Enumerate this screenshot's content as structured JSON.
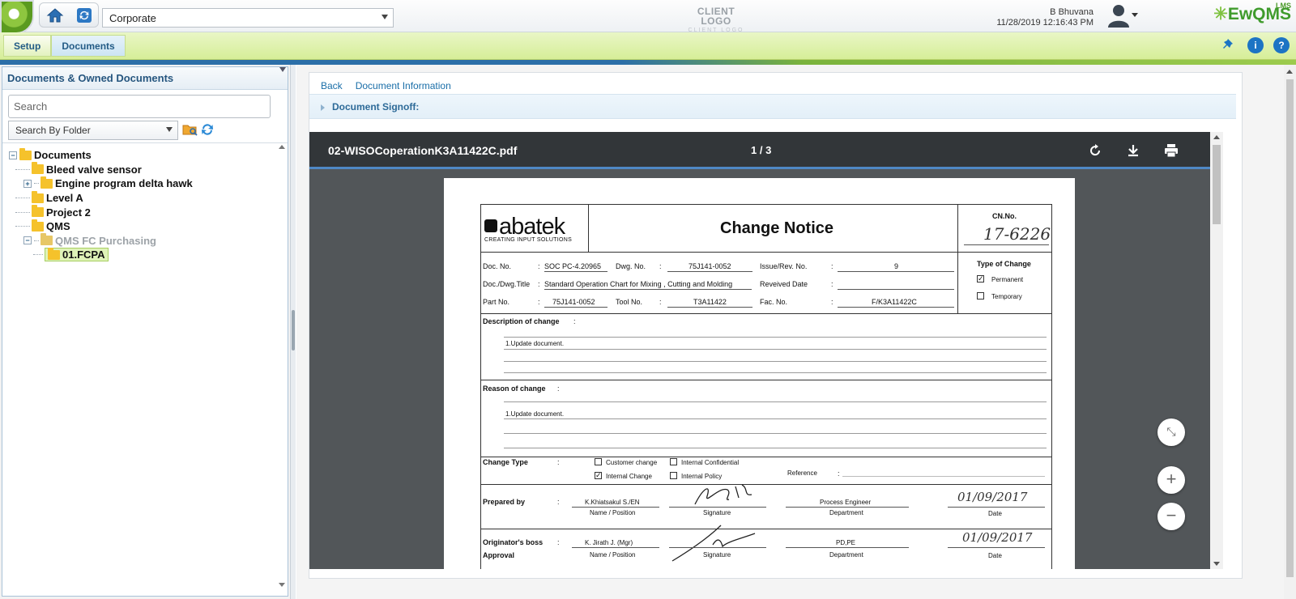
{
  "header": {
    "org_selector": "Corporate",
    "client_logo": "CLIENT LOGO",
    "client_logo_sub": "CLIENT LOGO",
    "user_name": "B Bhuvana",
    "datetime": "11/28/2019 12:16:43 PM",
    "brand": "EwQMS",
    "brand_sup": "LMS"
  },
  "nav": {
    "tabs": [
      "Setup",
      "Documents"
    ],
    "info_icon": "i",
    "help_icon": "?"
  },
  "sidebar": {
    "title": "Documents & Owned Documents",
    "search_placeholder": "Search",
    "search_by": "Search By Folder",
    "tree": {
      "root": "Documents",
      "items": [
        {
          "label": "Bleed valve sensor",
          "expandable": false
        },
        {
          "label": "Engine program delta hawk",
          "expandable": true
        },
        {
          "label": "Level A",
          "expandable": false
        },
        {
          "label": "Project 2",
          "expandable": false
        },
        {
          "label": "QMS",
          "expandable": false
        },
        {
          "label": "QMS FC Purchasing",
          "expandable": true,
          "expanded": true,
          "dimmed": true
        }
      ],
      "child": "01.FCPA"
    }
  },
  "content": {
    "back_link": "Back",
    "info_link": "Document Information",
    "signoff_label": "Document Signoff:",
    "viewer": {
      "filename": "02-WISOCoperationK3A11422C.pdf",
      "page_indicator": "1 / 3"
    }
  },
  "form": {
    "company": "abatek",
    "company_tagline": "CREATING INPUT SOLUTIONS",
    "title": "Change Notice",
    "cn_label": "CN.No.",
    "cn_value": "17-6226",
    "doc_no_label": "Doc. No.",
    "doc_no_value": "SOC PC-4.20965",
    "dwg_no_label": "Dwg. No.",
    "dwg_no_value": "75J141-0052",
    "issue_label": "Issue/Rev. No.",
    "issue_value": "9",
    "title_label": "Doc./Dwg.Title",
    "title_value": "Standard Operation Chart for Mixing , Cutting and Molding",
    "revised_label": "Reveived Date",
    "part_label": "Part No.",
    "part_value": "75J141-0052",
    "tool_label": "Tool No.",
    "tool_value": "T3A11422",
    "fac_label": "Fac. No.",
    "fac_value": "F/K3A11422C",
    "type_label": "Type of Change",
    "type_permanent": "Permanent",
    "type_temporary": "Temporary",
    "desc_label": "Description of change",
    "desc_value": "1.Update document.",
    "reason_label": "Reason of change",
    "reason_value": "1.Update document.",
    "change_type_label": "Change Type",
    "ct_customer": "Customer change",
    "ct_internal": "Internal Change",
    "ct_confidential": "Internal Confidential",
    "ct_policy": "Internal Policy",
    "reference_label": "Reference",
    "prepared_label": "Prepared by",
    "prepared_name": "K.Khiatsakul  S./EN",
    "prepared_dept": "Process Engineer",
    "prepared_date": "01/09/2017",
    "name_position": "Name / Position",
    "signature": "Signature",
    "department": "Department",
    "date": "Date",
    "boss_label": "Originator's boss",
    "approval_label": "Approval",
    "boss_name": "K. Jirath J. (Mgr)",
    "boss_dept": "PD,PE",
    "boss_date": "01/09/2017",
    "colon": ":"
  },
  "colors": {
    "nav_green": "#d6ee98",
    "link_blue": "#1a6ea8",
    "viewer_dark": "#323639",
    "viewer_accent": "#4f88c6",
    "folder_yellow": "#f5c22b"
  }
}
